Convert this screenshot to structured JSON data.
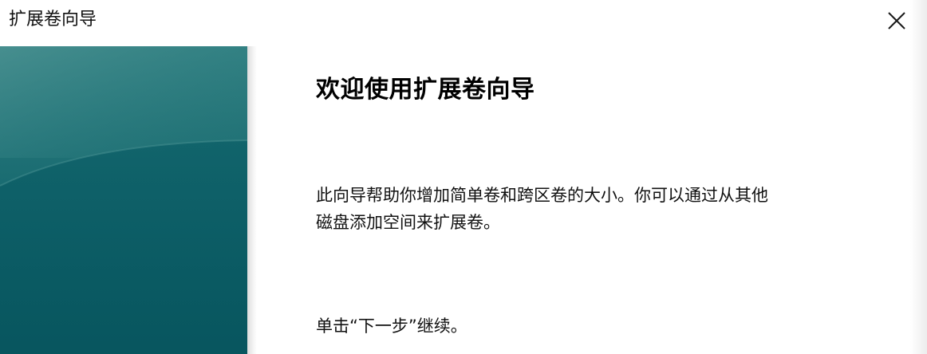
{
  "window": {
    "title": "扩展卷向导",
    "close_icon": "close-icon"
  },
  "banner": {
    "color_top": "#2f7e80",
    "color_bottom": "#0a5962"
  },
  "content": {
    "heading": "欢迎使用扩展卷向导",
    "description_line1": "此向导帮助你增加简单卷和跨区卷的大小。你可以通过从其他",
    "description_line2": "磁盘添加空间来扩展卷。",
    "continue_hint": "单击“下一步”继续。"
  }
}
